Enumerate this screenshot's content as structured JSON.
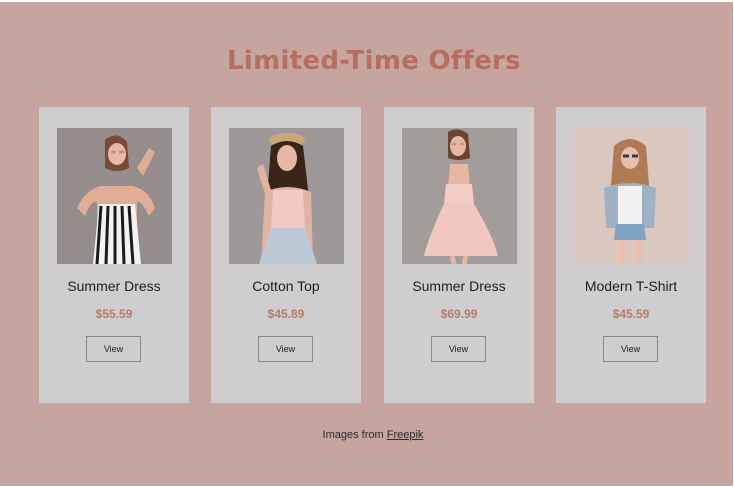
{
  "section": {
    "title": "Limited-Time Offers"
  },
  "products": [
    {
      "name": "Summer Dress",
      "price": "$55.59",
      "button_label": "View",
      "image": "woman-striped-dress-photo",
      "image_bg": "#8f8886"
    },
    {
      "name": "Cotton Top",
      "price": "$45.89",
      "button_label": "View",
      "image": "woman-straw-hat-photo",
      "image_bg": "#9d9998"
    },
    {
      "name": "Summer Dress",
      "price": "$69.99",
      "button_label": "View",
      "image": "woman-pink-dress-photo",
      "image_bg": "#a29c9a"
    },
    {
      "name": "Modern T-Shirt",
      "price": "$45.59",
      "button_label": "View",
      "image": "woman-denim-shorts-photo",
      "image_bg": "#d9c7c0"
    }
  ],
  "credit": {
    "prefix": "Images from",
    "link": "Freepik"
  },
  "colors": {
    "background": "#c6a59e",
    "card": "#cfcdcf",
    "title": "#b86e5e",
    "price": "#b97b6a"
  }
}
